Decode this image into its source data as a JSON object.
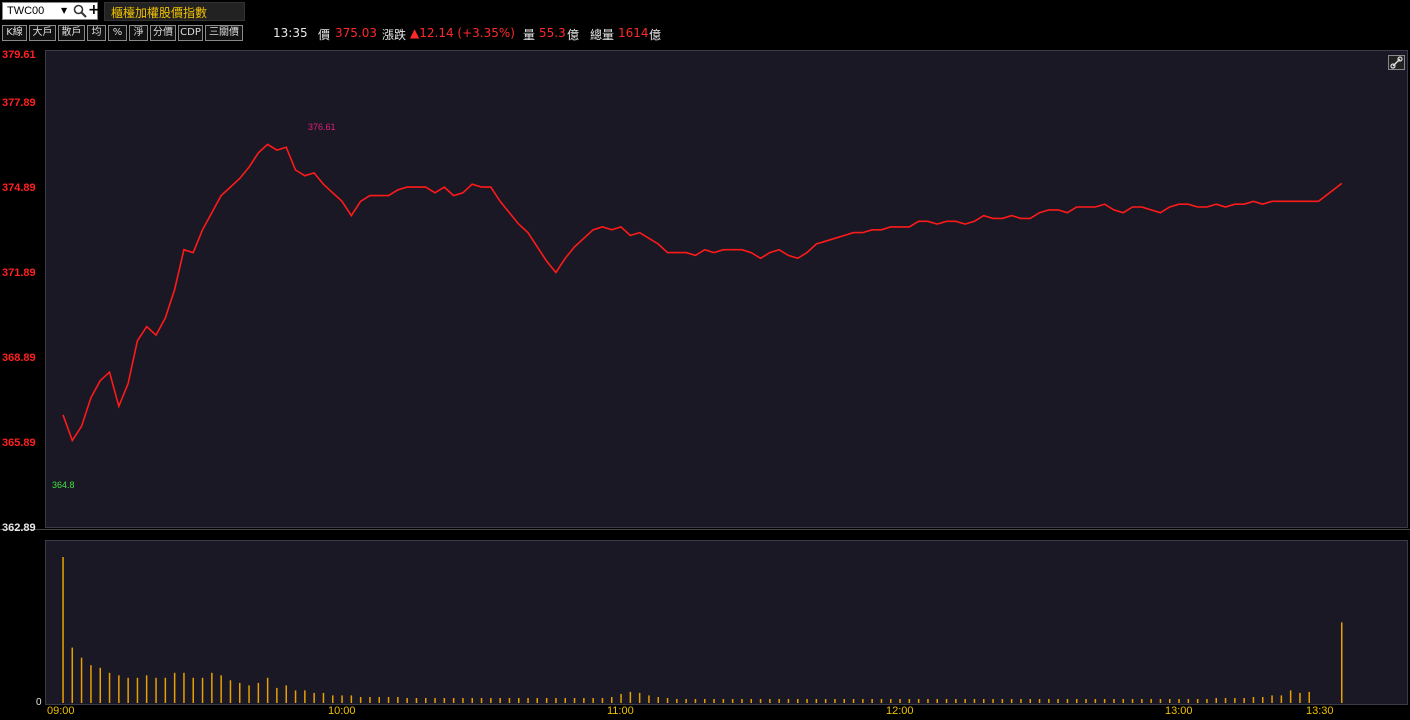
{
  "symbol": {
    "code": "TWC00",
    "title": "櫃檯加權股價指數"
  },
  "toolbar": [
    "K線",
    "大戶",
    "散戶",
    "均",
    "%",
    "淨",
    "分價",
    "CDP",
    "三關價"
  ],
  "quote": {
    "time": "13:35",
    "price_label": "價",
    "price": "375.03",
    "change_label": "漲跌",
    "change": "▲12.14 (+3.35%)",
    "vol_label": "量",
    "vol": "55.3",
    "vol_unit": "億",
    "total_label": "總量",
    "total": "1614",
    "total_unit": "億"
  },
  "y_labels": [
    "379.61",
    "377.89",
    "374.89",
    "371.89",
    "368.89",
    "365.89",
    "362.89"
  ],
  "x_labels": [
    "09:00",
    "10:00",
    "11:00",
    "12:00",
    "13:00",
    "13:30"
  ],
  "annotations": {
    "high": "376.61",
    "low": "364.8"
  },
  "volume_zero": "0",
  "colors": {
    "line": "#ff1a1a",
    "volume": "#e8a000",
    "up": "#ff2a2a",
    "axis_time": "#f0c000",
    "high": "#e0207a",
    "low": "#40e040"
  },
  "chart_data": {
    "type": "line",
    "series": [
      {
        "x": [
          "09:00",
          "09:02",
          "09:04",
          "09:06",
          "09:08",
          "09:10",
          "09:12",
          "09:14",
          "09:16",
          "09:18",
          "09:20",
          "09:22",
          "09:24",
          "09:26",
          "09:28",
          "09:30",
          "09:32",
          "09:34",
          "09:36",
          "09:38",
          "09:40",
          "09:42",
          "09:44",
          "09:46",
          "09:48",
          "09:50",
          "09:52",
          "09:54",
          "09:56",
          "09:58",
          "10:00",
          "10:02",
          "10:04",
          "10:06",
          "10:08",
          "10:10",
          "10:12",
          "10:14",
          "10:16",
          "10:18",
          "10:20",
          "10:22",
          "10:24",
          "10:26",
          "10:28",
          "10:30",
          "10:32",
          "10:34",
          "10:36",
          "10:38",
          "10:40",
          "10:42",
          "10:44",
          "10:46",
          "10:48",
          "10:50",
          "10:52",
          "10:54",
          "10:56",
          "10:58",
          "11:00",
          "11:02",
          "11:04",
          "11:06",
          "11:08",
          "11:10",
          "11:12",
          "11:14",
          "11:16",
          "11:18",
          "11:20",
          "11:22",
          "11:24",
          "11:26",
          "11:28",
          "11:30",
          "11:32",
          "11:34",
          "11:36",
          "11:38",
          "11:40",
          "11:42",
          "11:44",
          "11:46",
          "11:48",
          "11:50",
          "11:52",
          "11:54",
          "11:56",
          "11:58",
          "12:00",
          "12:02",
          "12:04",
          "12:06",
          "12:08",
          "12:10",
          "12:12",
          "12:14",
          "12:16",
          "12:18",
          "12:20",
          "12:22",
          "12:24",
          "12:26",
          "12:28",
          "12:30",
          "12:32",
          "12:34",
          "12:36",
          "12:38",
          "12:40",
          "12:42",
          "12:44",
          "12:46",
          "12:48",
          "12:50",
          "12:52",
          "12:54",
          "12:56",
          "12:58",
          "13:00",
          "13:02",
          "13:04",
          "13:06",
          "13:08",
          "13:10",
          "13:12",
          "13:14",
          "13:16",
          "13:18",
          "13:20",
          "13:22",
          "13:24",
          "13:26",
          "13:28",
          "13:30",
          "13:35"
        ],
        "values": [
          366.9,
          366.0,
          366.5,
          367.5,
          368.1,
          368.4,
          367.2,
          368.0,
          369.5,
          370.0,
          369.7,
          370.3,
          371.3,
          372.7,
          372.6,
          373.4,
          374.0,
          374.6,
          374.9,
          375.2,
          375.6,
          376.1,
          376.4,
          376.2,
          376.3,
          375.5,
          375.3,
          375.4,
          375.0,
          374.7,
          374.4,
          373.9,
          374.4,
          374.6,
          374.6,
          374.6,
          374.8,
          374.9,
          374.9,
          374.9,
          374.7,
          374.9,
          374.6,
          374.7,
          375.0,
          374.9,
          374.9,
          374.4,
          374.0,
          373.6,
          373.3,
          372.8,
          372.3,
          371.9,
          372.4,
          372.8,
          373.1,
          373.4,
          373.5,
          373.4,
          373.5,
          373.2,
          373.3,
          373.1,
          372.9,
          372.6,
          372.6,
          372.6,
          372.5,
          372.7,
          372.6,
          372.7,
          372.7,
          372.7,
          372.6,
          372.4,
          372.6,
          372.7,
          372.5,
          372.4,
          372.6,
          372.9,
          373.0,
          373.1,
          373.2,
          373.3,
          373.3,
          373.4,
          373.4,
          373.5,
          373.5,
          373.5,
          373.7,
          373.7,
          373.6,
          373.7,
          373.7,
          373.6,
          373.7,
          373.9,
          373.8,
          373.8,
          373.9,
          373.8,
          373.8,
          374.0,
          374.1,
          374.1,
          374.0,
          374.2,
          374.2,
          374.2,
          374.3,
          374.1,
          374.0,
          374.2,
          374.2,
          374.1,
          374.0,
          374.2,
          374.3,
          374.3,
          374.2,
          374.2,
          374.3,
          374.2,
          374.3,
          374.3,
          374.4,
          374.3,
          374.4,
          374.4,
          374.4,
          374.4,
          374.4,
          374.4,
          375.03
        ]
      }
    ],
    "volume": [
      2.9,
      1.1,
      0.9,
      0.75,
      0.7,
      0.6,
      0.55,
      0.5,
      0.5,
      0.55,
      0.5,
      0.5,
      0.6,
      0.6,
      0.5,
      0.5,
      0.6,
      0.55,
      0.45,
      0.4,
      0.35,
      0.4,
      0.5,
      0.3,
      0.35,
      0.25,
      0.25,
      0.2,
      0.2,
      0.15,
      0.15,
      0.15,
      0.12,
      0.12,
      0.12,
      0.12,
      0.12,
      0.1,
      0.1,
      0.1,
      0.1,
      0.1,
      0.1,
      0.1,
      0.1,
      0.1,
      0.1,
      0.1,
      0.1,
      0.1,
      0.1,
      0.1,
      0.1,
      0.1,
      0.1,
      0.1,
      0.1,
      0.1,
      0.1,
      0.12,
      0.18,
      0.22,
      0.2,
      0.15,
      0.12,
      0.1,
      0.08,
      0.08,
      0.08,
      0.08,
      0.08,
      0.08,
      0.08,
      0.08,
      0.08,
      0.08,
      0.08,
      0.08,
      0.08,
      0.08,
      0.08,
      0.08,
      0.08,
      0.08,
      0.08,
      0.08,
      0.08,
      0.08,
      0.08,
      0.08,
      0.08,
      0.08,
      0.08,
      0.08,
      0.08,
      0.08,
      0.08,
      0.08,
      0.08,
      0.08,
      0.08,
      0.08,
      0.08,
      0.08,
      0.08,
      0.08,
      0.08,
      0.08,
      0.08,
      0.08,
      0.08,
      0.08,
      0.08,
      0.08,
      0.08,
      0.08,
      0.08,
      0.08,
      0.08,
      0.08,
      0.08,
      0.08,
      0.08,
      0.08,
      0.1,
      0.1,
      0.1,
      0.1,
      0.12,
      0.12,
      0.15,
      0.15,
      0.25,
      0.2,
      0.22,
      0.0,
      1.6
    ],
    "xlabel": "",
    "ylabel": "",
    "ylim": [
      362.89,
      379.61
    ],
    "grid": false
  }
}
